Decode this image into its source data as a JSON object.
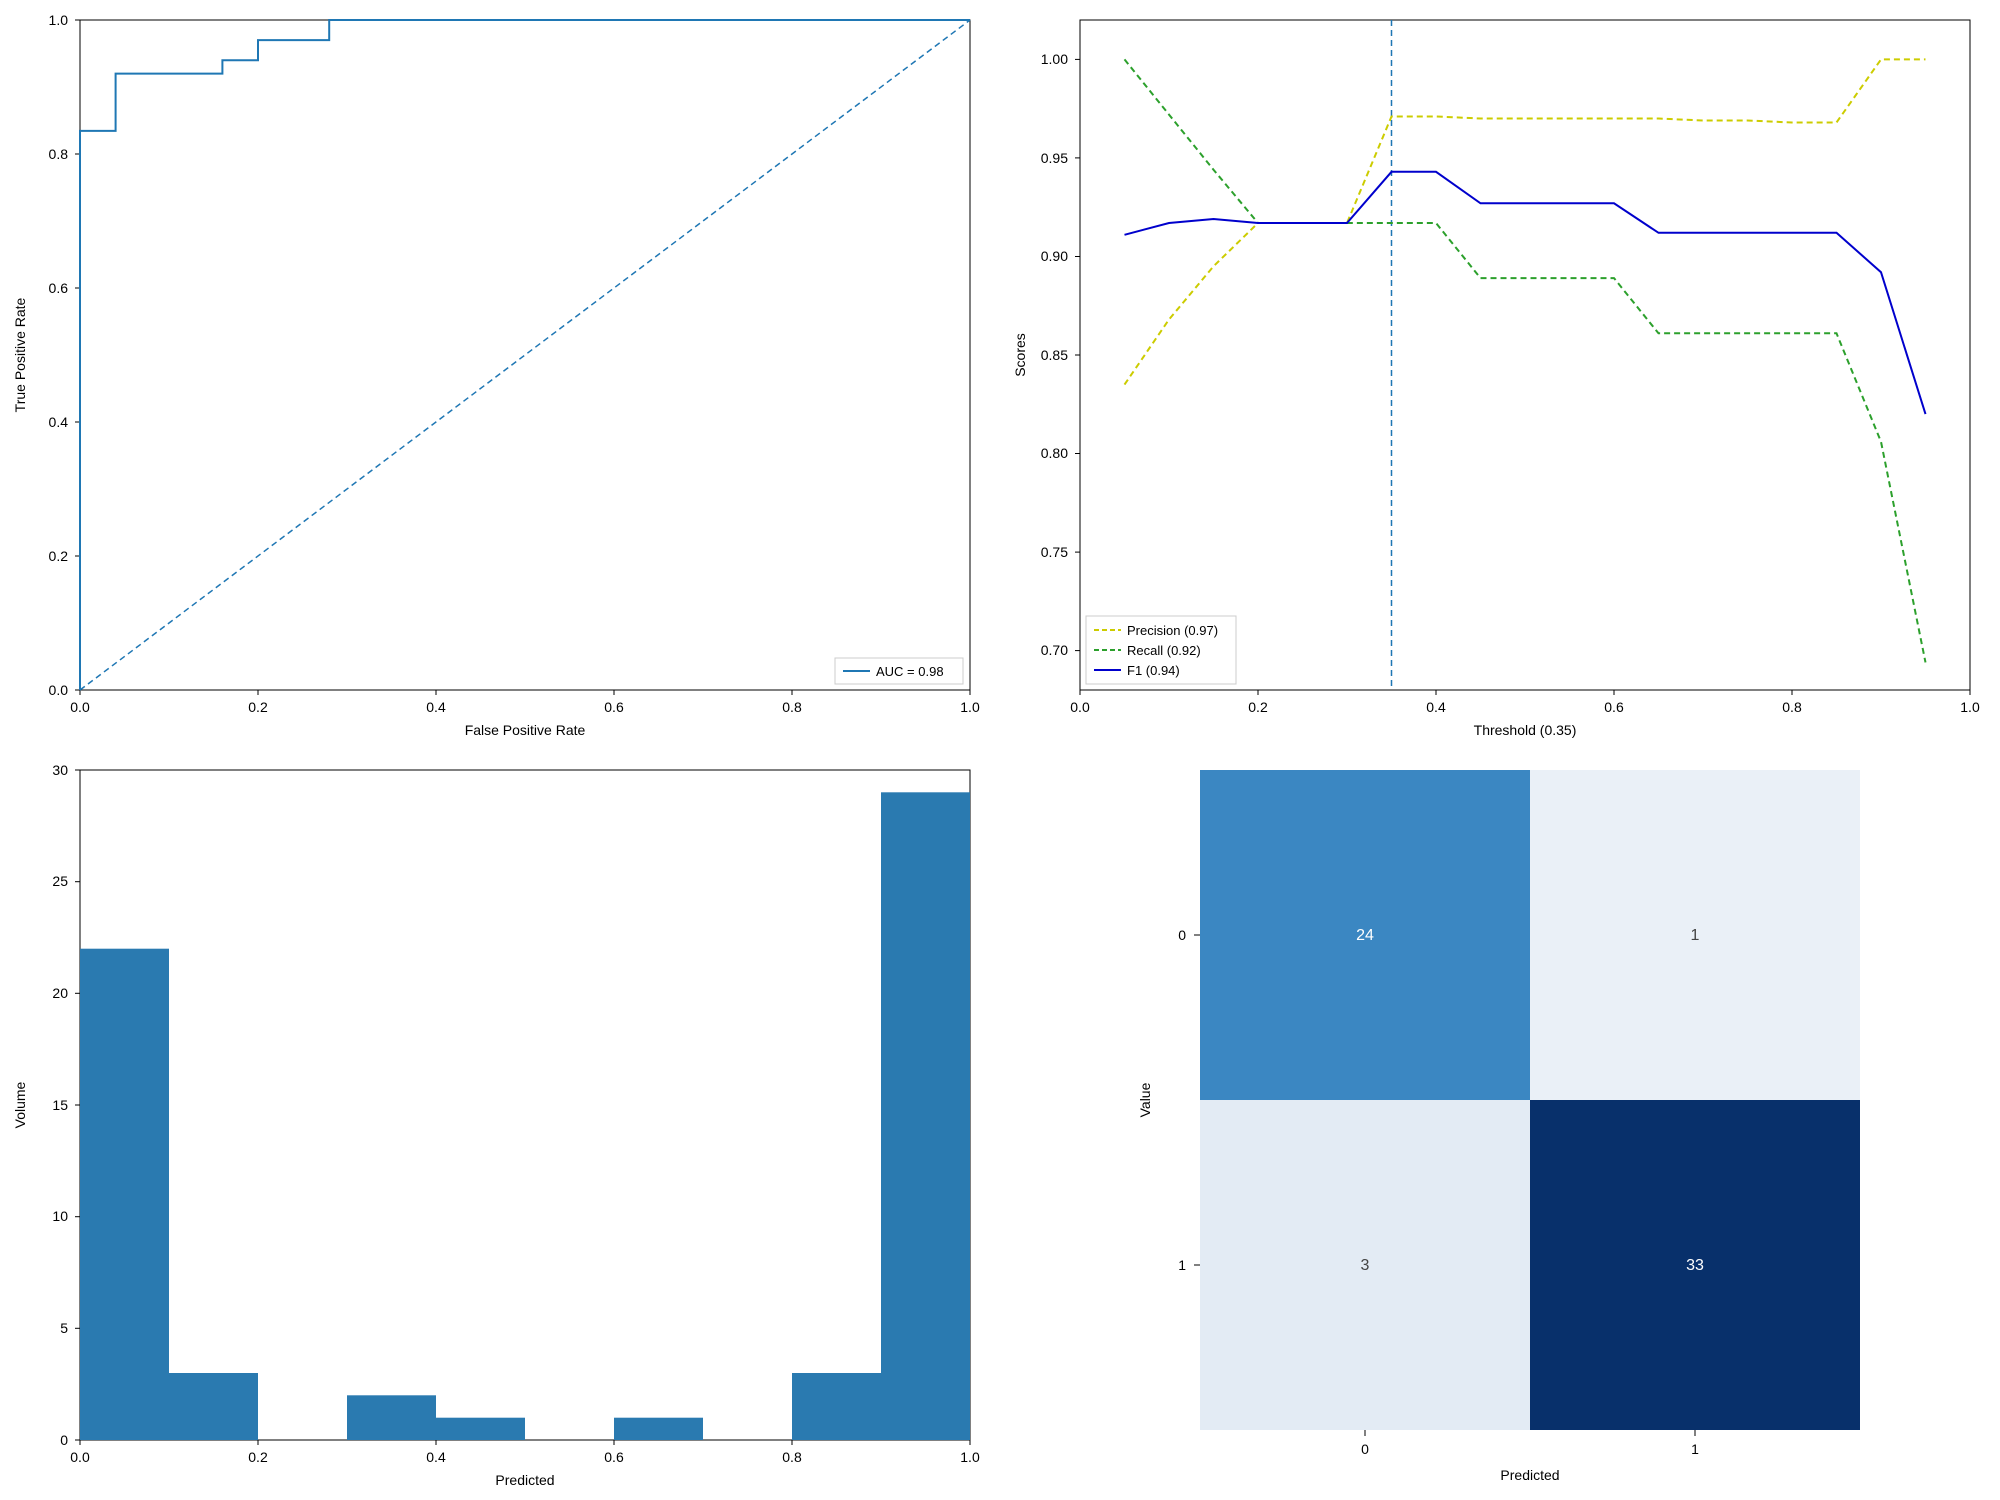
{
  "chart_data": [
    {
      "type": "line",
      "title": "",
      "xlabel": "False Positive Rate",
      "ylabel": "True Positive Rate",
      "xlim": [
        0.0,
        1.0
      ],
      "ylim": [
        0.0,
        1.0
      ],
      "x_ticks": [
        0.0,
        0.2,
        0.4,
        0.6,
        0.8,
        1.0
      ],
      "y_ticks": [
        0.0,
        0.2,
        0.4,
        0.6,
        0.8,
        1.0
      ],
      "series": [
        {
          "name": "ROC",
          "style": "solid",
          "color": "#1f77b4",
          "x": [
            0.0,
            0.0,
            0.04,
            0.04,
            0.16,
            0.16,
            0.2,
            0.2,
            0.28,
            0.28,
            1.0
          ],
          "y": [
            0.0,
            0.83,
            0.83,
            0.92,
            0.92,
            0.94,
            0.94,
            0.97,
            0.97,
            1.0,
            1.0
          ]
        },
        {
          "name": "diagonal",
          "style": "dashed",
          "color": "#1f77b4",
          "x": [
            0.0,
            1.0
          ],
          "y": [
            0.0,
            1.0
          ]
        }
      ],
      "legend": {
        "label": "AUC = 0.98",
        "position": "lower-right"
      }
    },
    {
      "type": "line",
      "title": "",
      "xlabel": "Threshold (0.35)",
      "ylabel": "Scores",
      "xlim": [
        0.0,
        1.0
      ],
      "ylim": [
        0.68,
        1.02
      ],
      "x_ticks": [
        0.0,
        0.2,
        0.4,
        0.6,
        0.8,
        1.0
      ],
      "y_ticks": [
        0.7,
        0.75,
        0.8,
        0.85,
        0.9,
        0.95,
        1.0
      ],
      "vline": 0.35,
      "series": [
        {
          "name": "Precision (0.97)",
          "style": "dashed",
          "color": "#cccc00",
          "x": [
            0.05,
            0.1,
            0.15,
            0.2,
            0.25,
            0.3,
            0.35,
            0.4,
            0.45,
            0.5,
            0.55,
            0.6,
            0.65,
            0.7,
            0.75,
            0.8,
            0.85,
            0.9,
            0.95
          ],
          "y": [
            0.835,
            0.868,
            0.895,
            0.917,
            0.917,
            0.917,
            0.971,
            0.971,
            0.97,
            0.97,
            0.97,
            0.97,
            0.97,
            0.969,
            0.969,
            0.968,
            0.968,
            1.0,
            1.0
          ]
        },
        {
          "name": "Recall (0.92)",
          "style": "dashed",
          "color": "#2ca02c",
          "x": [
            0.05,
            0.1,
            0.15,
            0.2,
            0.25,
            0.3,
            0.35,
            0.4,
            0.45,
            0.5,
            0.55,
            0.6,
            0.65,
            0.7,
            0.75,
            0.8,
            0.85,
            0.9,
            0.95
          ],
          "y": [
            1.0,
            0.972,
            0.944,
            0.917,
            0.917,
            0.917,
            0.917,
            0.917,
            0.889,
            0.889,
            0.889,
            0.889,
            0.861,
            0.861,
            0.861,
            0.861,
            0.861,
            0.806,
            0.694
          ]
        },
        {
          "name": "F1 (0.94)",
          "style": "solid",
          "color": "#0000cc",
          "x": [
            0.05,
            0.1,
            0.15,
            0.2,
            0.25,
            0.3,
            0.35,
            0.4,
            0.45,
            0.5,
            0.55,
            0.6,
            0.65,
            0.7,
            0.75,
            0.8,
            0.85,
            0.9,
            0.95
          ],
          "y": [
            0.911,
            0.917,
            0.919,
            0.917,
            0.917,
            0.917,
            0.943,
            0.943,
            0.927,
            0.927,
            0.927,
            0.927,
            0.912,
            0.912,
            0.912,
            0.912,
            0.912,
            0.892,
            0.82
          ]
        }
      ],
      "legend": {
        "position": "lower-left"
      }
    },
    {
      "type": "bar",
      "title": "",
      "xlabel": "Predicted",
      "ylabel": "Volume",
      "xlim": [
        0.0,
        1.0
      ],
      "ylim": [
        0,
        30
      ],
      "x_ticks": [
        0.0,
        0.2,
        0.4,
        0.6,
        0.8,
        1.0
      ],
      "y_ticks": [
        0,
        5,
        10,
        15,
        20,
        25,
        30
      ],
      "bin_edges": [
        0.0,
        0.1,
        0.2,
        0.3,
        0.4,
        0.5,
        0.6,
        0.7,
        0.8,
        0.9,
        1.0
      ],
      "values": [
        22,
        3,
        0,
        2,
        1,
        0,
        1,
        0,
        3,
        29
      ]
    },
    {
      "type": "heatmap",
      "title": "",
      "xlabel": "Predicted",
      "ylabel": "Value",
      "x_categories": [
        "0",
        "1"
      ],
      "y_categories": [
        "0",
        "1"
      ],
      "cells": [
        [
          24,
          1
        ],
        [
          3,
          33
        ]
      ]
    }
  ],
  "labels": {
    "roc": {
      "xlabel": "False Positive Rate",
      "ylabel": "True Positive Rate",
      "legend": "AUC = 0.98"
    },
    "thr": {
      "xlabel": "Threshold (0.35)",
      "ylabel": "Scores",
      "leg_p": "Precision (0.97)",
      "leg_r": "Recall (0.92)",
      "leg_f": "F1 (0.94)"
    },
    "hist": {
      "xlabel": "Predicted",
      "ylabel": "Volume"
    },
    "cm": {
      "xlabel": "Predicted",
      "ylabel": "Value",
      "xt0": "0",
      "xt1": "1",
      "yt0": "0",
      "yt1": "1",
      "c00": "24",
      "c01": "1",
      "c10": "3",
      "c11": "33"
    }
  },
  "ticks": {
    "dec": {
      "t0": "0.0",
      "t2": "0.2",
      "t4": "0.4",
      "t6": "0.6",
      "t8": "0.8",
      "t10": "1.0"
    },
    "thr_y": {
      "t70": "0.70",
      "t75": "0.75",
      "t80": "0.80",
      "t85": "0.85",
      "t90": "0.90",
      "t95": "0.95",
      "t100": "1.00"
    },
    "hist_y": {
      "t0": "0",
      "t5": "5",
      "t10": "10",
      "t15": "15",
      "t20": "20",
      "t25": "25",
      "t30": "30"
    }
  }
}
